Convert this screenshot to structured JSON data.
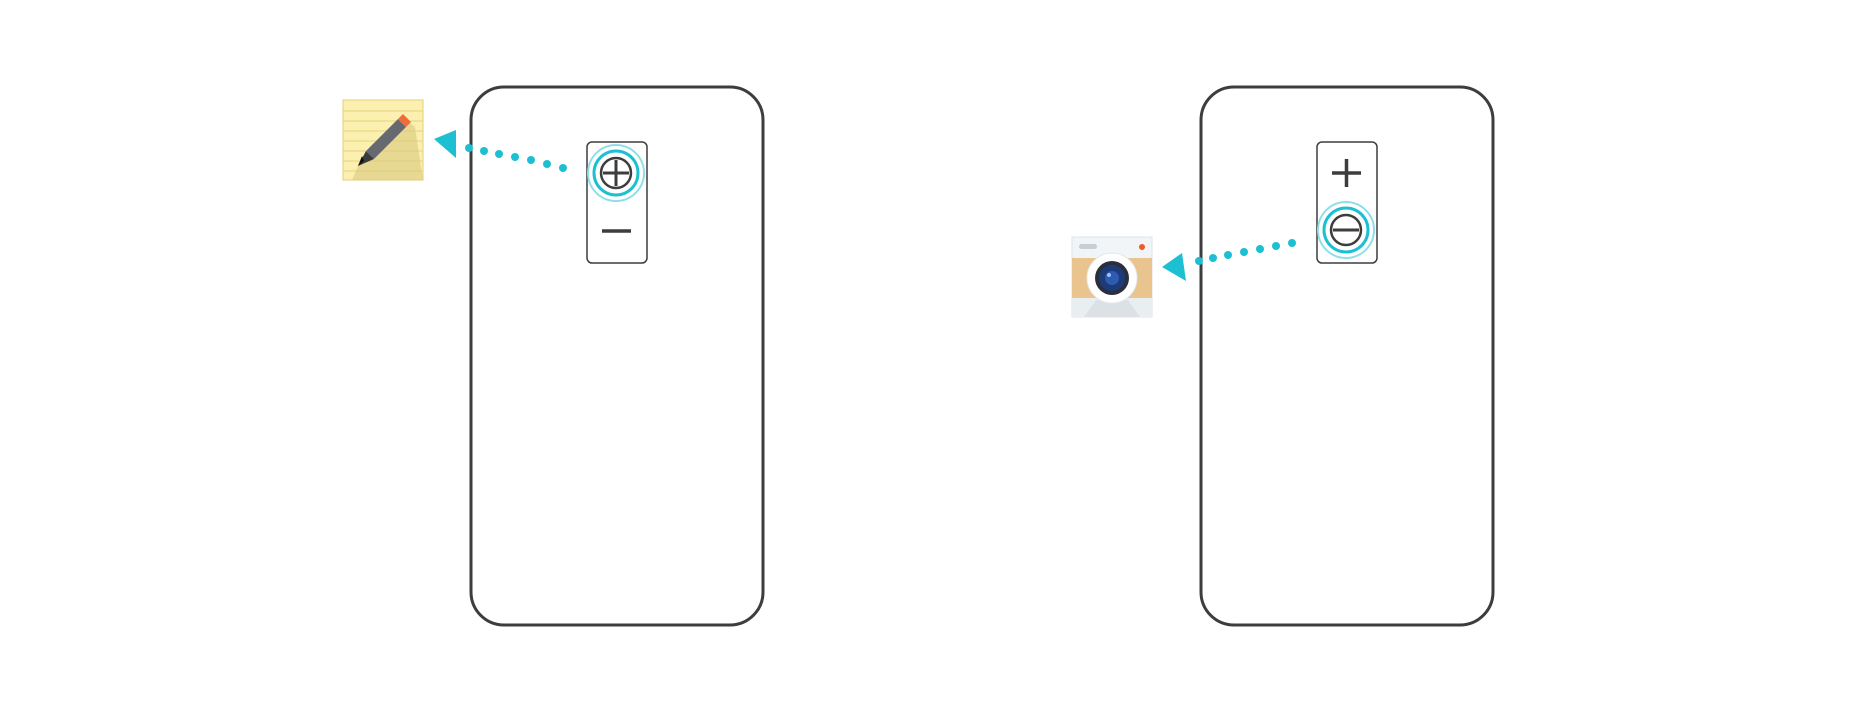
{
  "colors": {
    "background": "#ffffff",
    "outline": "#3d3d3d",
    "accent": "#1dbfd2",
    "accent_light": "#8fdfe9",
    "note_paper": "#fbf0b0",
    "note_lines": "#e6d27e",
    "camera_body": "#eac48f",
    "camera_top": "#f1f5f7",
    "camera_lens_blue": "#1d3b78",
    "camera_dot": "#f0582a"
  },
  "panels": [
    {
      "name": "phone-left",
      "pressed_key": "volume-up",
      "pressed_icon": "plus-icon",
      "released_icon": "minus-icon",
      "launched_app_icon": "notes-app-icon",
      "arrow_direction": "left"
    },
    {
      "name": "phone-right",
      "pressed_key": "volume-down",
      "pressed_icon": "minus-icon",
      "released_icon": "plus-icon",
      "launched_app_icon": "camera-app-icon",
      "arrow_direction": "left"
    }
  ]
}
